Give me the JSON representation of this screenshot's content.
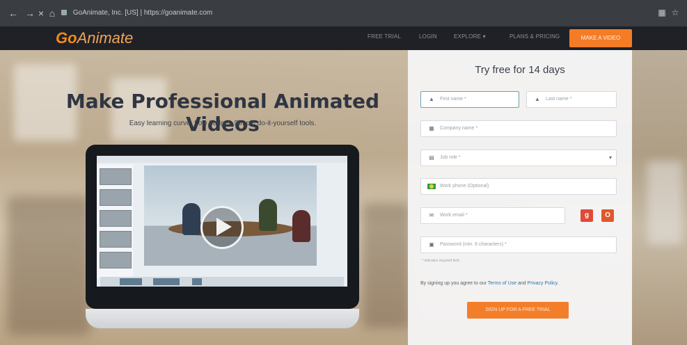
{
  "browser": {
    "url": "GoAnimate, Inc. [US] | https://goanimate.com",
    "nav_icons": [
      "back-arrow-icon",
      "close-icon",
      "home-icon"
    ],
    "extension_icons": [
      "extension-icon",
      "star-icon"
    ]
  },
  "site": {
    "logo_bold": "Go",
    "logo_rest": "Animate",
    "menu": [
      "FREE TRIAL",
      "LOGIN",
      "EXPLORE",
      "PLANS & PRICING"
    ],
    "cta": "MAKE A VIDEO",
    "accent_color": "#f47c27"
  },
  "hero": {
    "headline": "Make Professional Animated Videos",
    "subline": "Easy learning curve. Low budget. Simple do-it-yourself tools."
  },
  "signup": {
    "title": "Try free for 14 days",
    "fields": {
      "first_name": {
        "placeholder": "First name *"
      },
      "last_name": {
        "placeholder": "Last name *"
      },
      "company": {
        "placeholder": "Company name *"
      },
      "job_role": {
        "value": "Job role *"
      },
      "phone": {
        "placeholder": "Work phone (Optional)"
      },
      "email": {
        "placeholder": "Work email *"
      },
      "password": {
        "placeholder": "Password (min. 6 characters) *"
      }
    },
    "required_note": "* Indicates required field",
    "terms_prefix": "By signing up you agree to our",
    "terms_link": "Terms of Use",
    "terms_and": "and",
    "privacy_link": "Privacy Policy.",
    "button": "SIGN UP FOR A FREE TRIAL"
  }
}
